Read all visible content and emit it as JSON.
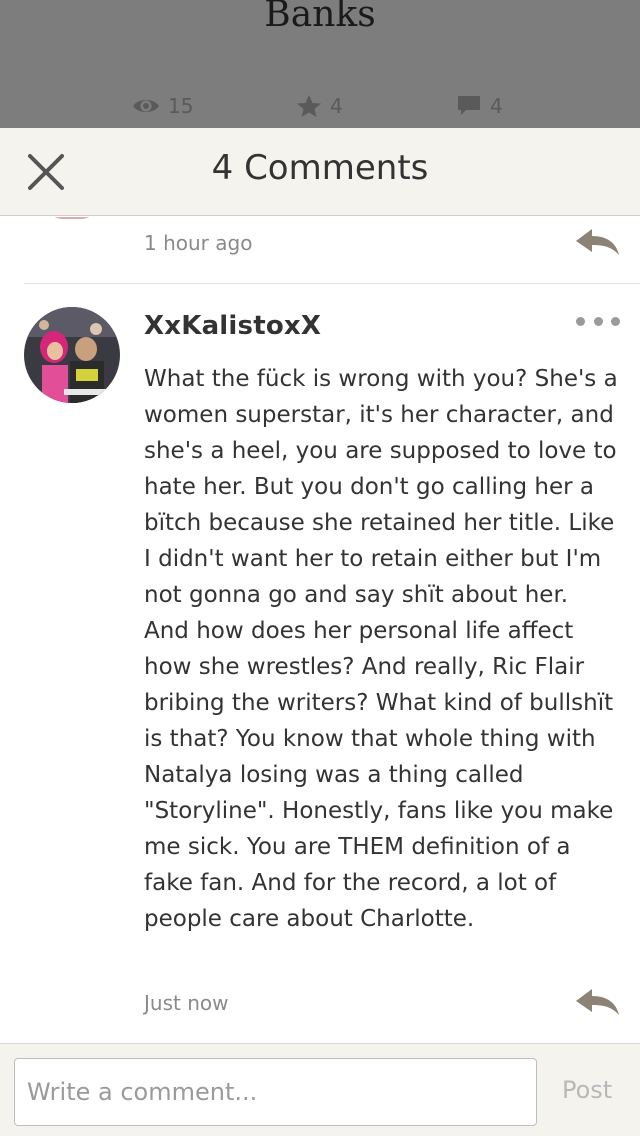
{
  "story": {
    "title_fragment": "Banks",
    "stats": {
      "views": "15",
      "votes": "4",
      "comments": "4"
    }
  },
  "sheet": {
    "title": "4 Comments"
  },
  "comments": [
    {
      "time": "1 hour ago"
    },
    {
      "username": "XxKalistoxX",
      "text": "What the fück is wrong with you? She's a women superstar, it's her character, and she's a heel, you are supposed to love to hate her. But you don't go calling her a bïtch because she retained her title. Like I didn't want her to retain either but I'm not gonna go and say shït about her. And how does her personal life affect how she wrestles? And really, Ric Flair bribing the writers? What kind of bullshït is that? You know that whole thing with Natalya losing was a thing called \"Storyline\". Honestly, fans like you make me sick. You are THEM definition of a fake fan. And for the record, a lot of people care about Charlotte.",
      "time": "Just now"
    }
  ],
  "compose": {
    "placeholder": "Write a comment...",
    "post_label": "Post"
  },
  "icons": {
    "views": "eye-icon",
    "votes": "star-icon",
    "comments": "speech-bubble-icon",
    "close": "close-icon",
    "reply": "reply-arrow-icon",
    "more": "more-dots-icon"
  },
  "colors": {
    "overlay": "#7d7d7d",
    "sheet_bg": "#f5f3ee",
    "text": "#333333",
    "muted": "#8a8a8a",
    "reply_icon": "#8c8276"
  }
}
